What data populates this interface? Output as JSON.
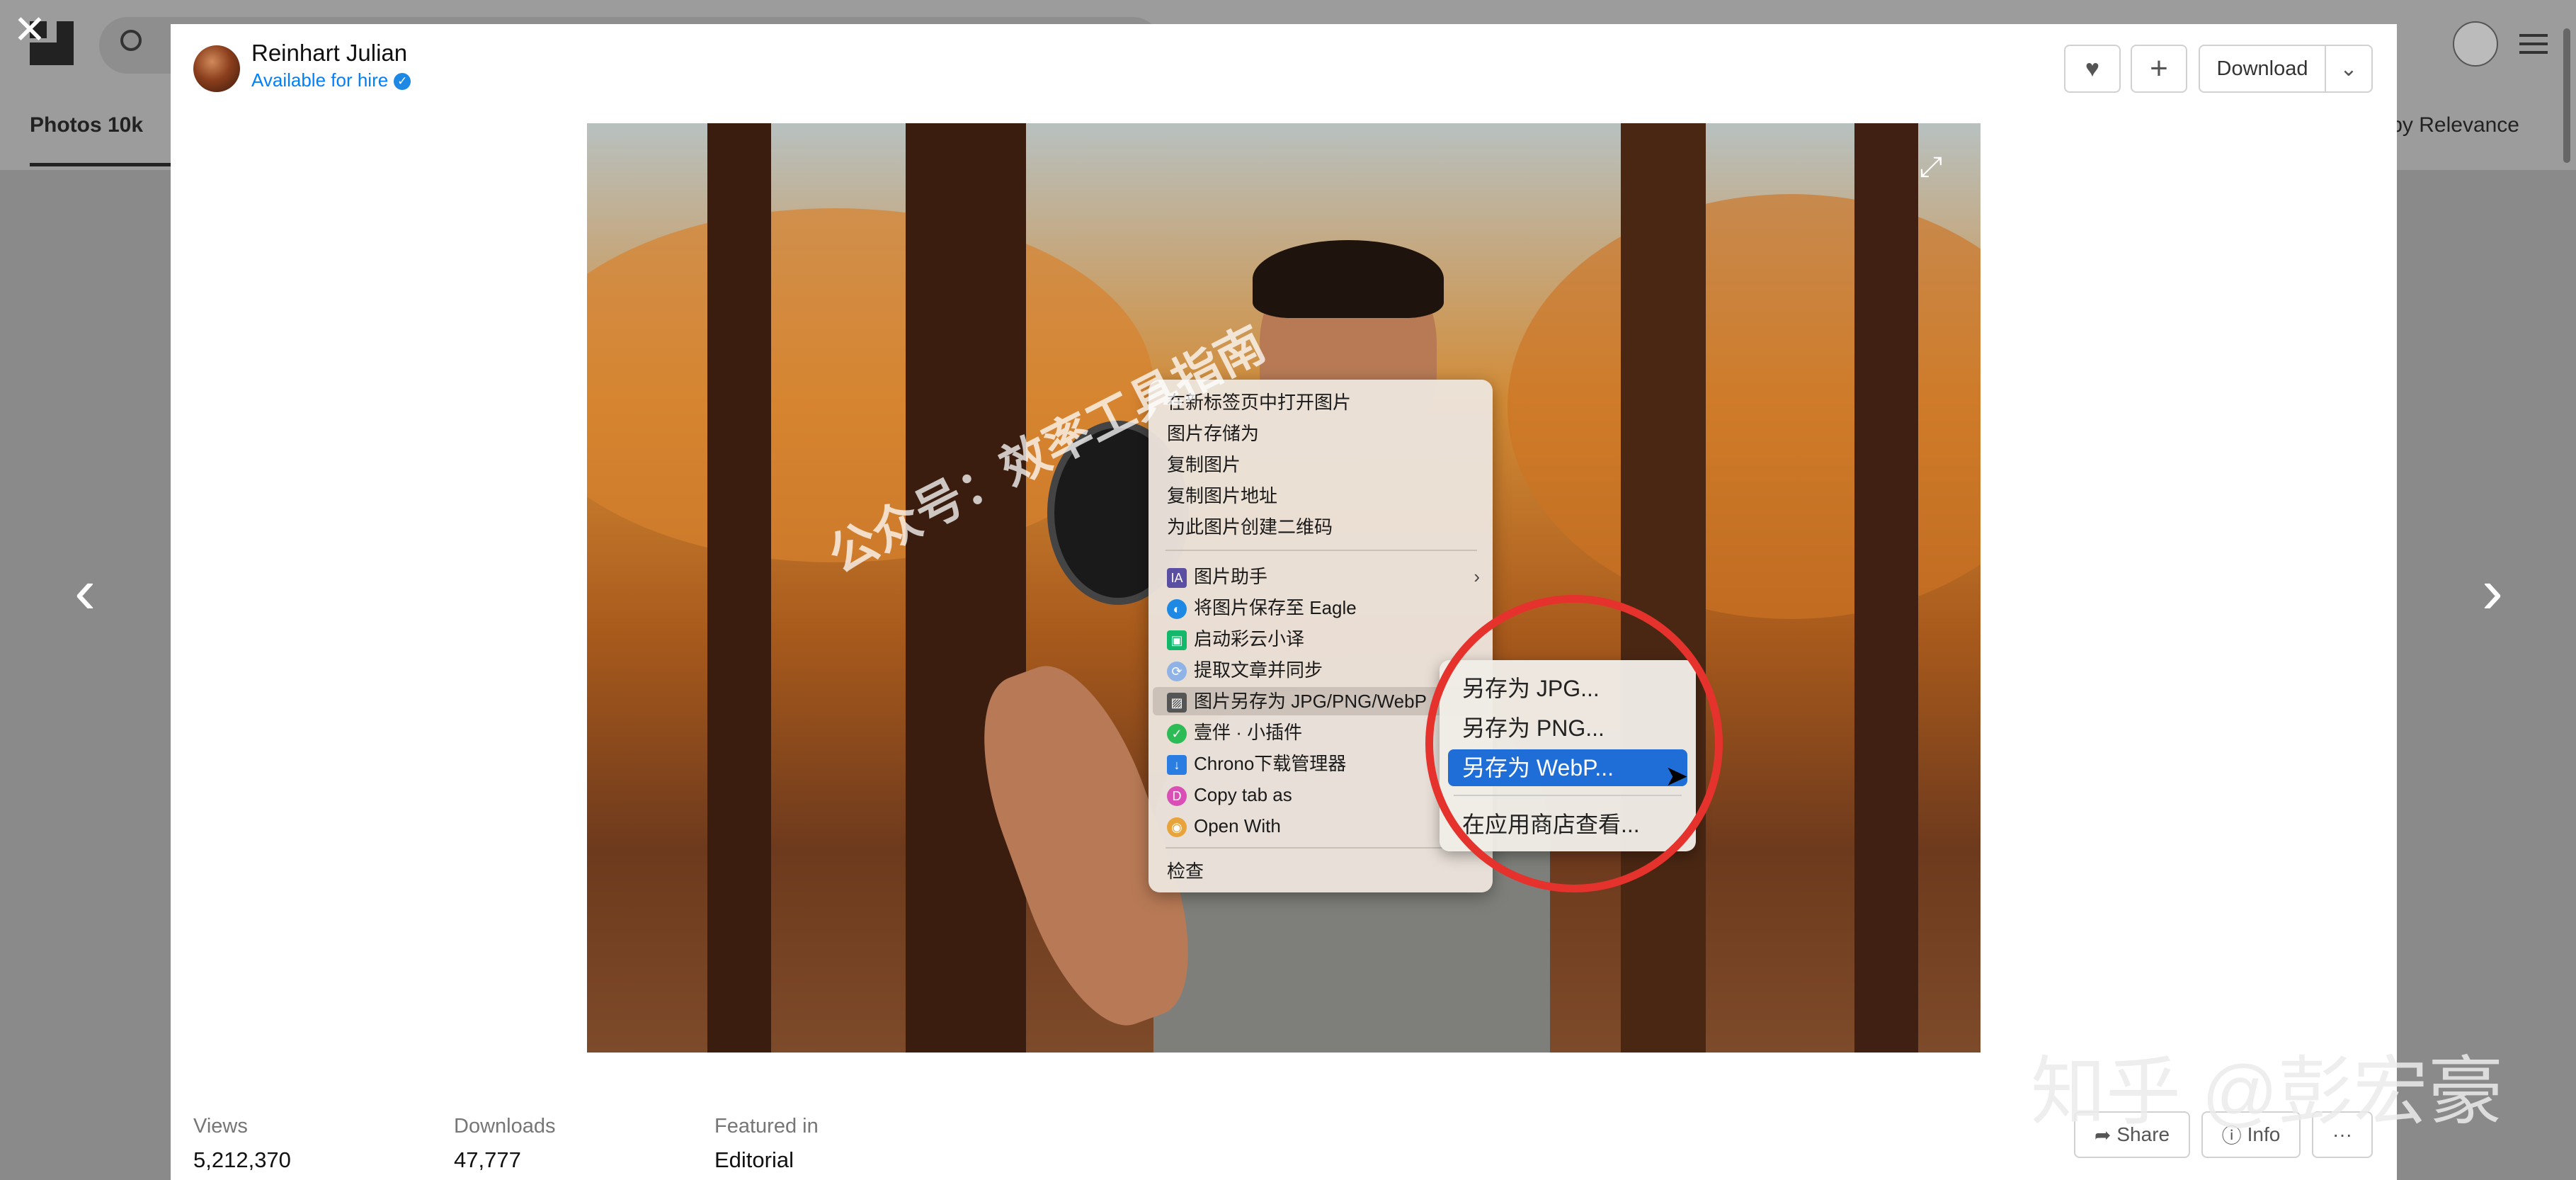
{
  "background": {
    "tab_label": "Photos 10k",
    "sort_label": "by Relevance"
  },
  "nav": {
    "close": "✕",
    "prev": "‹",
    "next": "›"
  },
  "author": {
    "name": "Reinhart Julian",
    "hire": "Available for hire",
    "verified_icon": "✓"
  },
  "toolbar": {
    "like": "♥",
    "add": "+",
    "download": "Download",
    "dropdown": "⌄"
  },
  "context_menu": {
    "items": [
      "在新标签页中打开图片",
      "图片存储为",
      "复制图片",
      "复制图片地址",
      "为此图片创建二维码"
    ],
    "ext_items": [
      "图片助手",
      "将图片保存至 Eagle",
      "启动彩云小译",
      "提取文章并同步",
      "图片另存为 JPG/PNG/WebP",
      "壹伴 · 小插件",
      "Chrono下载管理器",
      "Copy tab as",
      "Open With"
    ],
    "inspect": "检查",
    "icon_labels": [
      "IA",
      "◐",
      "▣",
      "⟳",
      "▨",
      "✓",
      "↓",
      "D",
      "◉"
    ],
    "arrow": "›"
  },
  "submenu": {
    "items": [
      "另存为 JPG...",
      "另存为 PNG...",
      "另存为 WebP...",
      "在应用商店查看..."
    ],
    "accent": "#1f6ed8"
  },
  "watermark": {
    "diag": "公众号：效率工具指南",
    "corner": "知乎 @彭宏豪"
  },
  "stats": {
    "views_label": "Views",
    "views": "5,212,370",
    "downloads_label": "Downloads",
    "downloads": "47,777",
    "featured_label": "Featured in",
    "featured": "Editorial"
  },
  "footer": {
    "share": "Share",
    "info": "Info",
    "more": "···"
  },
  "colors": {
    "highlight_circle": "#e5322d",
    "link_blue": "#007fff"
  }
}
